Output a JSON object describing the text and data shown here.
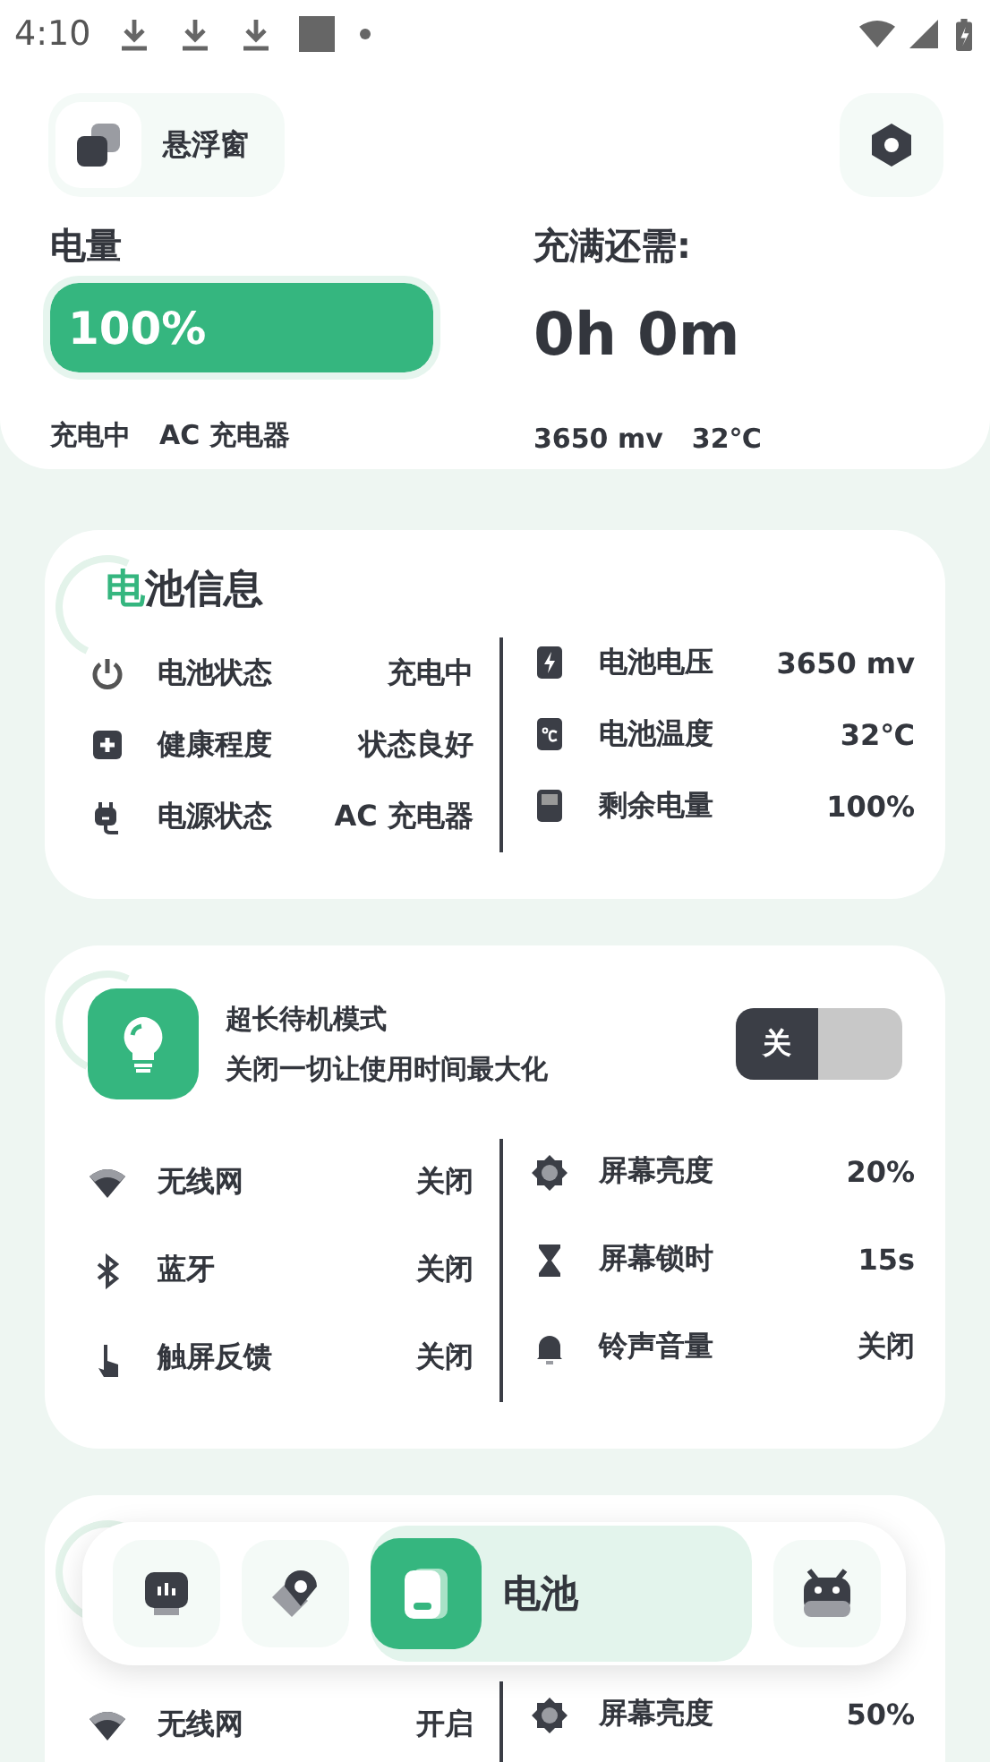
{
  "status_bar": {
    "time": "4:10",
    "notifications": [
      {
        "kind": "download"
      },
      {
        "kind": "download"
      },
      {
        "kind": "download"
      },
      {
        "kind": "square"
      },
      {
        "kind": "dot"
      }
    ]
  },
  "header": {
    "float_window": {
      "label": "悬浮窗"
    }
  },
  "battery": {
    "label": "电量",
    "level": 1,
    "percent": "100%",
    "state": "充电中",
    "source": "AC 充电器",
    "remaining_label": "充满还需:",
    "remaining": "0h 0m",
    "voltage": "3650 mv",
    "temperature": "32℃"
  },
  "info_card": {
    "title_accent": "电",
    "title_rest": "池信息",
    "left": [
      {
        "kind": "power",
        "label": "电池状态",
        "value": "充电中"
      },
      {
        "kind": "health",
        "label": "健康程度",
        "value": "状态良好"
      },
      {
        "kind": "plug",
        "label": "电源状态",
        "value": "AC 充电器"
      }
    ],
    "right": [
      {
        "kind": "voltage",
        "label": "电池电压",
        "value": "3650 mv"
      },
      {
        "kind": "temperature",
        "label": "电池温度",
        "value": "32℃"
      },
      {
        "kind": "battery",
        "label": "剩余电量",
        "value": "100%"
      }
    ]
  },
  "modes": [
    {
      "title": "超长待机模式",
      "subtitle": "关闭一切让使用时间最大化",
      "toggle": {
        "label": "关",
        "on": false
      },
      "left": [
        {
          "kind": "wifi",
          "label": "无线网",
          "value": "关闭"
        },
        {
          "kind": "bluetooth",
          "label": "蓝牙",
          "value": "关闭"
        },
        {
          "kind": "touch",
          "label": "触屏反馈",
          "value": "关闭"
        }
      ],
      "right": [
        {
          "kind": "brightness",
          "label": "屏幕亮度",
          "value": "20%"
        },
        {
          "kind": "hourglass",
          "label": "屏幕锁时",
          "value": "15s"
        },
        {
          "kind": "bell",
          "label": "铃声音量",
          "value": "关闭"
        }
      ]
    },
    {
      "left": [
        {
          "kind": "wifi",
          "label": "无线网",
          "value": "开启"
        }
      ],
      "right": [
        {
          "kind": "brightness",
          "label": "屏幕亮度",
          "value": "50%"
        }
      ]
    }
  ],
  "nav": [
    {
      "kind": "monitor",
      "selected": false
    },
    {
      "kind": "location",
      "selected": false
    },
    {
      "kind": "battery",
      "label": "电池",
      "selected": true
    },
    {
      "kind": "robot",
      "selected": false
    }
  ]
}
